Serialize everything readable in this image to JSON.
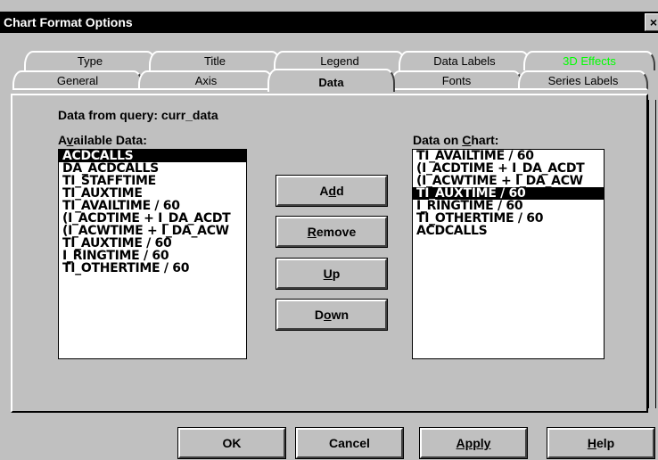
{
  "window": {
    "title": "Chart Format Options",
    "close_glyph": "×"
  },
  "tabs_back": [
    {
      "label": "Type"
    },
    {
      "label": "Title"
    },
    {
      "label": "Legend"
    },
    {
      "label": "Data Labels"
    },
    {
      "label": "3D Effects",
      "color": "#00ff00"
    }
  ],
  "tabs_front": [
    {
      "label": "General"
    },
    {
      "label": "Axis"
    },
    {
      "label": "Data",
      "active": true
    },
    {
      "label": "Fonts"
    },
    {
      "label": "Series Labels"
    }
  ],
  "data_tab": {
    "query_label": "Data from query: curr_data",
    "available_label": {
      "pre": "A",
      "accel": "v",
      "post": "ailable Data:"
    },
    "available_items": [
      "ACDCALLS",
      "DA_ACDCALLS",
      "TI_STAFFTIME",
      "TI_AUXTIME",
      "TI_AVAILTIME / 60",
      "(I_ACDTIME + I_DA_ACDT",
      "(I_ACWTIME + I_DA_ACW",
      "TI_AUXTIME / 60",
      "I_RINGTIME / 60",
      "TI_OTHERTIME / 60"
    ],
    "available_selected_index": 0,
    "chart_label": {
      "pre": "Data on ",
      "accel": "C",
      "post": "hart:"
    },
    "chart_items": [
      "TI_AVAILTIME / 60",
      "(I_ACDTIME + I_DA_ACDT",
      "(I_ACWTIME + I_DA_ACW",
      "TI_AUXTIME / 60",
      "I_RINGTIME / 60",
      "TI_OTHERTIME / 60",
      "ACDCALLS"
    ],
    "chart_selected_index": 3,
    "buttons": {
      "add": {
        "pre": "A",
        "accel": "d",
        "post": "d"
      },
      "remove": {
        "pre": "",
        "accel": "R",
        "post": "emove"
      },
      "up": {
        "pre": "",
        "accel": "U",
        "post": "p"
      },
      "down": {
        "pre": "D",
        "accel": "o",
        "post": "wn"
      }
    }
  },
  "footer": {
    "ok": {
      "pre": "OK",
      "accel": "",
      "post": ""
    },
    "cancel": {
      "pre": "Cancel",
      "accel": "",
      "post": ""
    },
    "apply": {
      "pre": "",
      "accel": "Apply",
      "post": ""
    },
    "help": {
      "pre": "",
      "accel": "H",
      "post": "elp"
    }
  }
}
